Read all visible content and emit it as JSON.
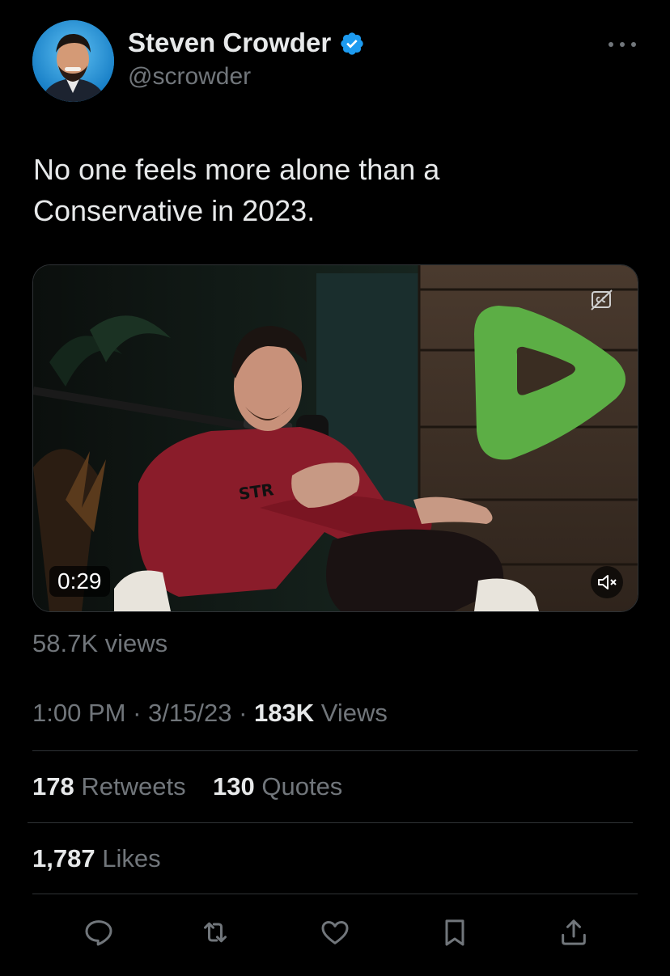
{
  "author": {
    "display_name": "Steven Crowder",
    "handle": "@scrowder",
    "verified": true,
    "verified_color": "#1d9bf0"
  },
  "tweet": {
    "text": "No one feels more alone than a Conservative in 2023."
  },
  "video": {
    "duration": "0:29",
    "shirt_text": "STR",
    "logo_color": "#5cae45",
    "icons": [
      "closed-captions-icon",
      "muted-speaker-icon"
    ]
  },
  "video_views": {
    "count": "58.7K",
    "label": "views"
  },
  "meta": {
    "time": "1:00 PM",
    "date": "3/15/23",
    "views_count": "183K",
    "views_label": "Views"
  },
  "stats": {
    "retweets_count": "178",
    "retweets_label": "Retweets",
    "quotes_count": "130",
    "quotes_label": "Quotes",
    "likes_count": "1,787",
    "likes_label": "Likes"
  },
  "actions": [
    "reply-icon",
    "retweet-icon",
    "like-icon",
    "bookmark-icon",
    "share-icon"
  ]
}
